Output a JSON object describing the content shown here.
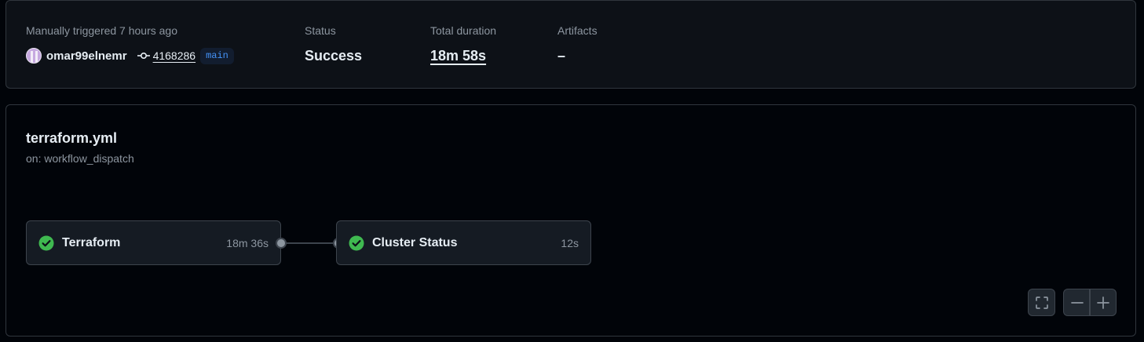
{
  "summary": {
    "trigger_text": "Manually triggered 7 hours ago",
    "actor": "omar99elnemr",
    "commit": "4168286",
    "branch": "main",
    "status_label": "Status",
    "status_value": "Success",
    "duration_label": "Total duration",
    "duration_value": "18m 58s",
    "artifacts_label": "Artifacts",
    "artifacts_value": "–"
  },
  "workflow": {
    "file_name": "terraform.yml",
    "trigger": "on: workflow_dispatch",
    "jobs": [
      {
        "name": "Terraform",
        "duration": "18m 36s",
        "status": "success",
        "icon": "check-circle-icon"
      },
      {
        "name": "Cluster Status",
        "duration": "12s",
        "status": "success",
        "icon": "check-circle-icon"
      }
    ]
  },
  "controls": {
    "fullscreen_icon": "fullscreen-icon",
    "zoom_out_icon": "zoom-out-icon",
    "zoom_in_icon": "zoom-in-icon"
  },
  "colors": {
    "success": "#3fb950",
    "link_blue": "#4493f8",
    "border": "#30363d",
    "muted_text": "#8d96a0"
  }
}
